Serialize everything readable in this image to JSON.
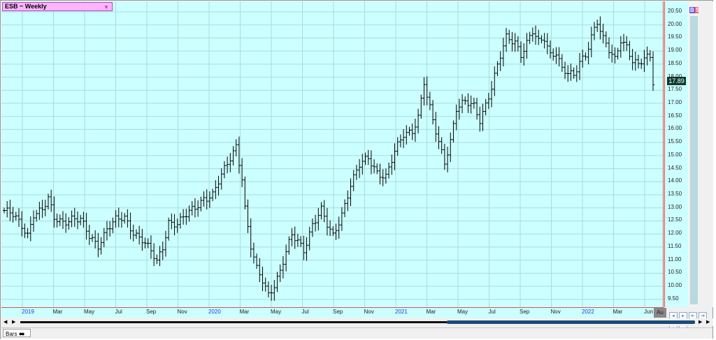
{
  "header": {
    "symbol_label": "ESB ~ Weekly",
    "dropdown_glyph": "▼"
  },
  "badges": {
    "buy": "B",
    "sell": "S"
  },
  "footer": {
    "tab_label": "Bars",
    "tab_icon": "glasses-icon",
    "date_tag": "Au",
    "nav_buttons": [
      "zoom-out-icon",
      "zoom-in-icon",
      "scroll-left-icon",
      "scroll-right-icon",
      "add-icon",
      "remove-icon"
    ]
  },
  "colors": {
    "plot_bg": "#ccffff",
    "grid": "#a8dcdc",
    "bar": "#000000",
    "axis_line": "#e05050",
    "price_tag_bg": "#0d3b2e",
    "year_label": "#1e3cdc"
  },
  "chart_data": {
    "type": "ohlc",
    "title": "ESB ~ Weekly",
    "last_price": "17.89",
    "price_labels": [
      "20.50",
      "20.00",
      "19.50",
      "19.00",
      "18.50",
      "18.00",
      "17.50",
      "17.00",
      "16.50",
      "16.00",
      "15.50",
      "15.00",
      "14.50",
      "14.00",
      "13.50",
      "13.00",
      "12.50",
      "12.00",
      "11.50",
      "11.00",
      "10.50",
      "10.00",
      "9.50"
    ],
    "date_labels": [
      {
        "text": "2019",
        "year": true
      },
      {
        "text": "Mar",
        "year": false
      },
      {
        "text": "May",
        "year": false
      },
      {
        "text": "Jul",
        "year": false
      },
      {
        "text": "Sep",
        "year": false
      },
      {
        "text": "Nov",
        "year": false
      },
      {
        "text": "2020",
        "year": true
      },
      {
        "text": "Mar",
        "year": false
      },
      {
        "text": "May",
        "year": false
      },
      {
        "text": "Jul",
        "year": false
      },
      {
        "text": "Sep",
        "year": false
      },
      {
        "text": "Nov",
        "year": false
      },
      {
        "text": "2021",
        "year": true
      },
      {
        "text": "Mar",
        "year": false
      },
      {
        "text": "May",
        "year": false
      },
      {
        "text": "Jul",
        "year": false
      },
      {
        "text": "Sep",
        "year": false
      },
      {
        "text": "Nov",
        "year": false
      },
      {
        "text": "2022",
        "year": true
      },
      {
        "text": "Mar",
        "year": false
      },
      {
        "text": "Jun",
        "year": false
      }
    ],
    "ylim": [
      9.2,
      20.9
    ],
    "grid": true,
    "anchors": [
      [
        0,
        12.9
      ],
      [
        3,
        12.7
      ],
      [
        6,
        12.3
      ],
      [
        8,
        12.0
      ],
      [
        10,
        12.8
      ],
      [
        13,
        12.9
      ],
      [
        15,
        13.3
      ],
      [
        17,
        12.6
      ],
      [
        20,
        12.5
      ],
      [
        23,
        12.6
      ],
      [
        26,
        12.5
      ],
      [
        29,
        11.9
      ],
      [
        32,
        11.6
      ],
      [
        35,
        12.2
      ],
      [
        38,
        12.5
      ],
      [
        41,
        12.6
      ],
      [
        44,
        12.1
      ],
      [
        47,
        11.8
      ],
      [
        50,
        11.3
      ],
      [
        52,
        10.9
      ],
      [
        54,
        11.5
      ],
      [
        56,
        12.5
      ],
      [
        59,
        12.4
      ],
      [
        62,
        12.7
      ],
      [
        65,
        13.0
      ],
      [
        68,
        13.4
      ],
      [
        71,
        13.5
      ],
      [
        74,
        14.2
      ],
      [
        77,
        14.9
      ],
      [
        79,
        15.4
      ],
      [
        81,
        14.2
      ],
      [
        82,
        13.0
      ],
      [
        84,
        11.5
      ],
      [
        86,
        10.6
      ],
      [
        88,
        10.2
      ],
      [
        90,
        9.7
      ],
      [
        92,
        10.1
      ],
      [
        94,
        10.6
      ],
      [
        96,
        11.3
      ],
      [
        98,
        11.9
      ],
      [
        100,
        11.7
      ],
      [
        102,
        11.4
      ],
      [
        105,
        12.4
      ],
      [
        108,
        12.9
      ],
      [
        110,
        12.3
      ],
      [
        112,
        11.9
      ],
      [
        115,
        12.8
      ],
      [
        118,
        13.9
      ],
      [
        121,
        14.6
      ],
      [
        124,
        14.9
      ],
      [
        127,
        14.4
      ],
      [
        130,
        14.2
      ],
      [
        133,
        15.1
      ],
      [
        136,
        15.8
      ],
      [
        139,
        16.0
      ],
      [
        141,
        16.5
      ],
      [
        143,
        17.8
      ],
      [
        144,
        17.2
      ],
      [
        146,
        16.3
      ],
      [
        148,
        15.5
      ],
      [
        150,
        14.8
      ],
      [
        152,
        15.6
      ],
      [
        154,
        16.8
      ],
      [
        157,
        17.0
      ],
      [
        160,
        16.9
      ],
      [
        162,
        16.4
      ],
      [
        164,
        17.0
      ],
      [
        166,
        17.6
      ],
      [
        168,
        18.4
      ],
      [
        171,
        19.5
      ],
      [
        174,
        19.4
      ],
      [
        176,
        18.9
      ],
      [
        178,
        19.3
      ],
      [
        180,
        19.7
      ],
      [
        182,
        19.3
      ],
      [
        184,
        19.5
      ],
      [
        186,
        18.9
      ],
      [
        188,
        19.0
      ],
      [
        190,
        18.3
      ],
      [
        192,
        18.1
      ],
      [
        194,
        18.0
      ],
      [
        196,
        18.6
      ],
      [
        198,
        18.9
      ],
      [
        200,
        19.6
      ],
      [
        202,
        20.1
      ],
      [
        204,
        19.4
      ],
      [
        206,
        19.0
      ],
      [
        208,
        18.7
      ],
      [
        210,
        19.5
      ],
      [
        212,
        19.2
      ],
      [
        214,
        18.6
      ],
      [
        216,
        18.4
      ],
      [
        218,
        18.7
      ],
      [
        220,
        18.8
      ],
      [
        221,
        17.89
      ]
    ],
    "n_bars": 222
  }
}
